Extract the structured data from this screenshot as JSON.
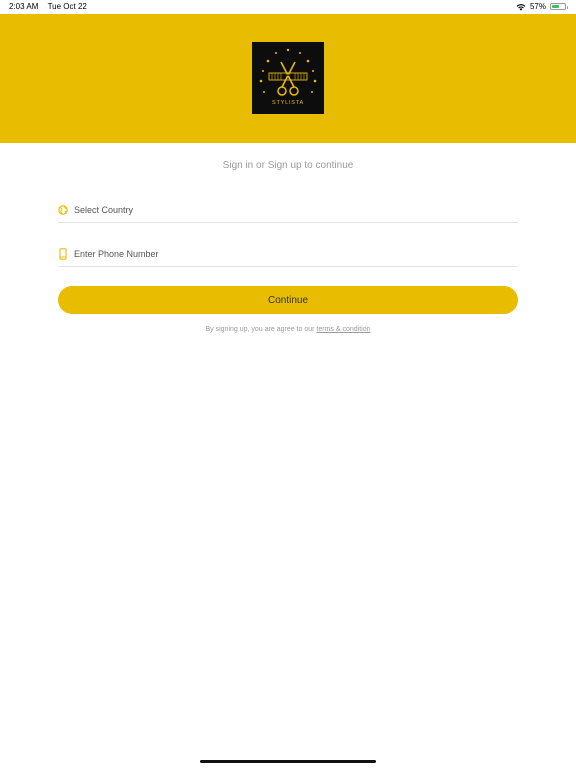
{
  "status_bar": {
    "time": "2:03 AM",
    "date": "Tue Oct 22",
    "battery_percent": "57%",
    "battery_level": 0.57,
    "icons": [
      "wifi-icon",
      "battery-icon"
    ]
  },
  "header": {
    "background_color": "#e8bc00",
    "logo_text": "STYLISTA"
  },
  "form": {
    "subtitle": "Sign in or Sign up to continue",
    "country_placeholder": "Select Country",
    "country_icon": "globe-icon",
    "phone_placeholder": "Enter Phone Number",
    "phone_icon": "mobile-phone-icon",
    "continue_label": "Continue"
  },
  "terms": {
    "prefix": "By signing up, you are agree to our ",
    "link_label": "terms & condition"
  },
  "colors": {
    "accent": "#e8bc00",
    "text_muted": "#9a9a9a"
  }
}
